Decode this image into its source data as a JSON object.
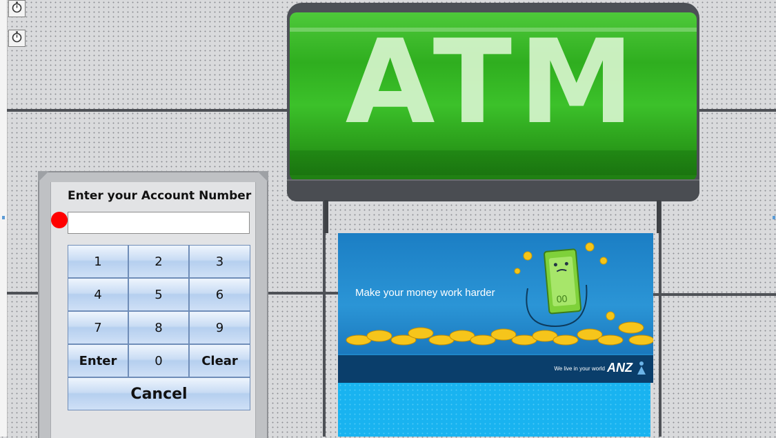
{
  "timers": [
    {
      "icon": "stopwatch-icon"
    },
    {
      "icon": "stopwatch-icon"
    }
  ],
  "sign": {
    "text": "ATM",
    "color": "#33b324"
  },
  "banner": {
    "headline": "Make your money work harder",
    "tagline": "We live in your world",
    "logo": "ANZ",
    "colors": {
      "sky": "#1f86c8",
      "footer": "#0a3e6b",
      "lower": "#19b3f0"
    }
  },
  "keypad_panel": {
    "prompt": "Enter your Account Number",
    "account_input": {
      "value": "",
      "placeholder": ""
    },
    "status_color": "#ff0000",
    "keys": [
      "1",
      "2",
      "3",
      "4",
      "5",
      "6",
      "7",
      "8",
      "9",
      "Enter",
      "0",
      "Clear"
    ],
    "cancel": "Cancel"
  }
}
